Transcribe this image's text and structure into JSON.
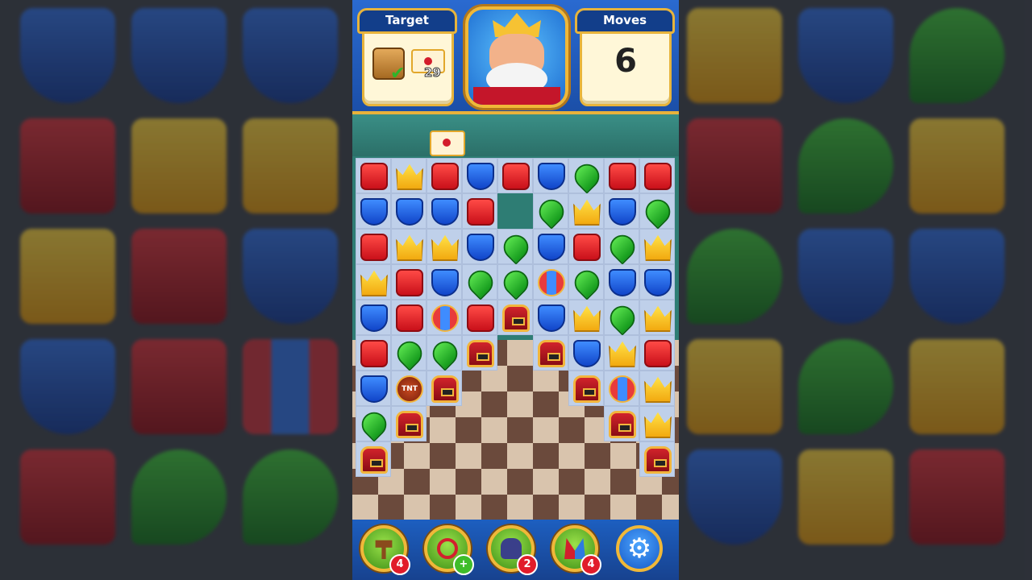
{
  "header": {
    "target_title": "Target",
    "moves_title": "Moves",
    "moves_value": "6",
    "target_items": [
      {
        "icon": "wooden-box-icon",
        "status": "complete"
      },
      {
        "icon": "envelope-icon",
        "remaining": "29"
      }
    ]
  },
  "board": {
    "rows": [
      [
        "red",
        "yellow",
        "red",
        "blue",
        "red",
        "blue",
        "green",
        "red",
        "red"
      ],
      [
        "blue",
        "blue",
        "blue",
        "red",
        "",
        "green",
        "yellow",
        "blue",
        "green"
      ],
      [
        "red",
        "yellow",
        "yellow",
        "blue",
        "green",
        "blue",
        "red",
        "green",
        "yellow"
      ],
      [
        "yellow",
        "red",
        "blue",
        "green",
        "green",
        "rocket",
        "green",
        "blue",
        "blue"
      ],
      [
        "blue",
        "red",
        "rocket",
        "red",
        "chest",
        "blue",
        "yellow",
        "green",
        "yellow"
      ],
      [
        "red",
        "green",
        "green",
        "chest",
        "",
        "chest",
        "blue",
        "yellow",
        "red"
      ],
      [
        "blue",
        "tnt",
        "chest",
        "",
        "",
        "",
        "chest",
        "rocket",
        "yellow"
      ],
      [
        "green",
        "chest",
        "",
        "",
        "",
        "",
        "",
        "chest",
        "yellow"
      ],
      [
        "chest",
        "",
        "",
        "",
        "",
        "",
        "",
        "",
        "chest"
      ]
    ],
    "tnt_label": "TNT"
  },
  "toolbar": {
    "boosters": [
      {
        "name": "hammer-booster",
        "icon": "hammer-icon",
        "count": "4"
      },
      {
        "name": "arrow-booster",
        "icon": "arrow-icon",
        "count": "+"
      },
      {
        "name": "cannon-booster",
        "icon": "cannon-icon",
        "count": "2"
      },
      {
        "name": "jester-hat-booster",
        "icon": "jester-hat-icon",
        "count": "4"
      }
    ],
    "settings_icon": "gear-icon"
  },
  "colors": {
    "panel_blue": "#1d4f9a",
    "gold_border": "#e7b43c",
    "cream": "#fff7d8"
  }
}
